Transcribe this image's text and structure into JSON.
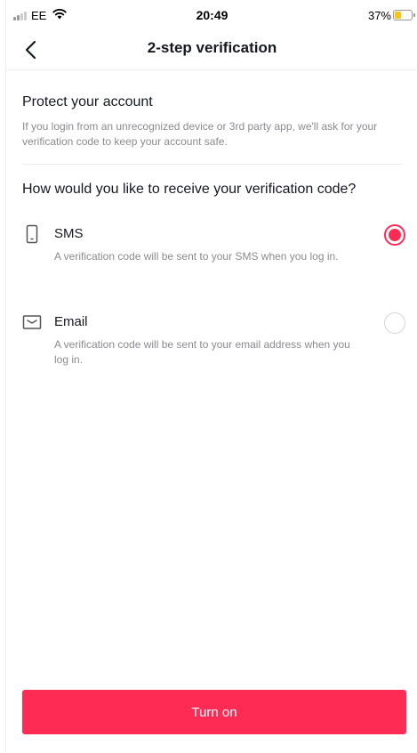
{
  "status_bar": {
    "carrier": "EE",
    "time": "20:49",
    "battery_pct": "37%",
    "battery_level": 0.37,
    "icons": [
      "signal-icon",
      "wifi-icon",
      "battery-icon"
    ]
  },
  "header": {
    "back_icon": "chevron-left-icon",
    "title": "2-step verification"
  },
  "protect": {
    "title": "Protect your account",
    "description": "If you login from an unrecognized device or 3rd party app, we'll ask for your verification code to keep your account safe."
  },
  "question": "How would you like to receive your verification code?",
  "options": [
    {
      "icon": "phone-icon",
      "label": "SMS",
      "description": "A verification code will be sent to your SMS when you log in.",
      "selected": true
    },
    {
      "icon": "envelope-icon",
      "label": "Email",
      "description": "A verification code will be sent to your email address when you log in.",
      "selected": false
    }
  ],
  "button": {
    "label": "Turn on"
  },
  "colors": {
    "accent": "#fe2c55",
    "text": "#161823",
    "secondary_text": "#8a8b91"
  }
}
